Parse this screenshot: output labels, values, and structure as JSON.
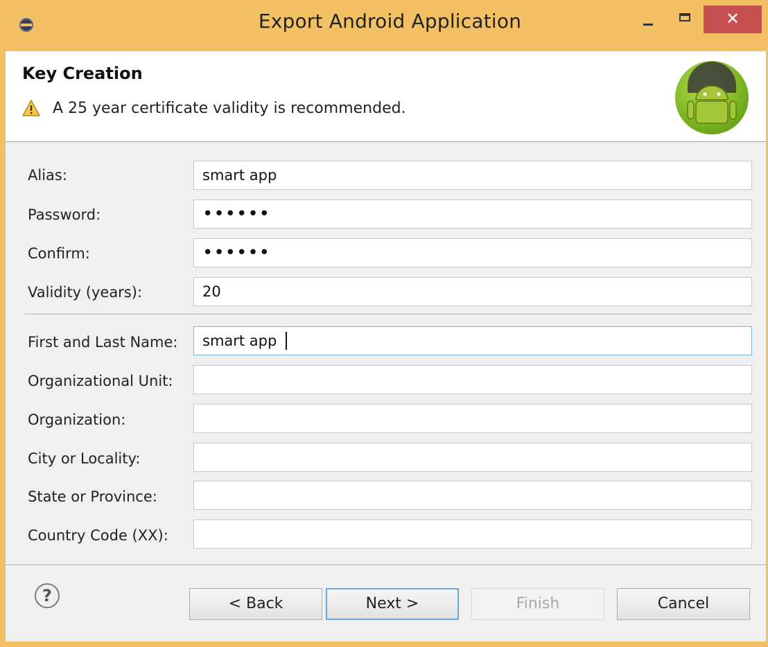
{
  "window": {
    "title": "Export Android Application",
    "close_glyph": "✕"
  },
  "header": {
    "title": "Key Creation",
    "message": "A 25 year certificate validity is recommended.",
    "message_icon": "warning-icon",
    "logo_icon": "android-logo-icon"
  },
  "form": {
    "alias": {
      "label": "Alias:",
      "value": "smart app"
    },
    "password": {
      "label": "Password:",
      "value": "••••••"
    },
    "confirm": {
      "label": "Confirm:",
      "value": "••••••"
    },
    "validity": {
      "label": "Validity (years):",
      "value": "20"
    },
    "first_last_name": {
      "label": "First and Last Name:",
      "value": "smart app"
    },
    "org_unit": {
      "label": "Organizational Unit:",
      "value": ""
    },
    "organization": {
      "label": "Organization:",
      "value": ""
    },
    "city": {
      "label": "City or Locality:",
      "value": ""
    },
    "state": {
      "label": "State or Province:",
      "value": ""
    },
    "country": {
      "label": "Country Code (XX):",
      "value": ""
    }
  },
  "buttons": {
    "help_glyph": "?",
    "back": "< Back",
    "next": "Next >",
    "finish": "Finish",
    "cancel": "Cancel"
  },
  "colors": {
    "frame": "#f3c164",
    "close": "#c75050",
    "focus": "#7ab3e0"
  }
}
